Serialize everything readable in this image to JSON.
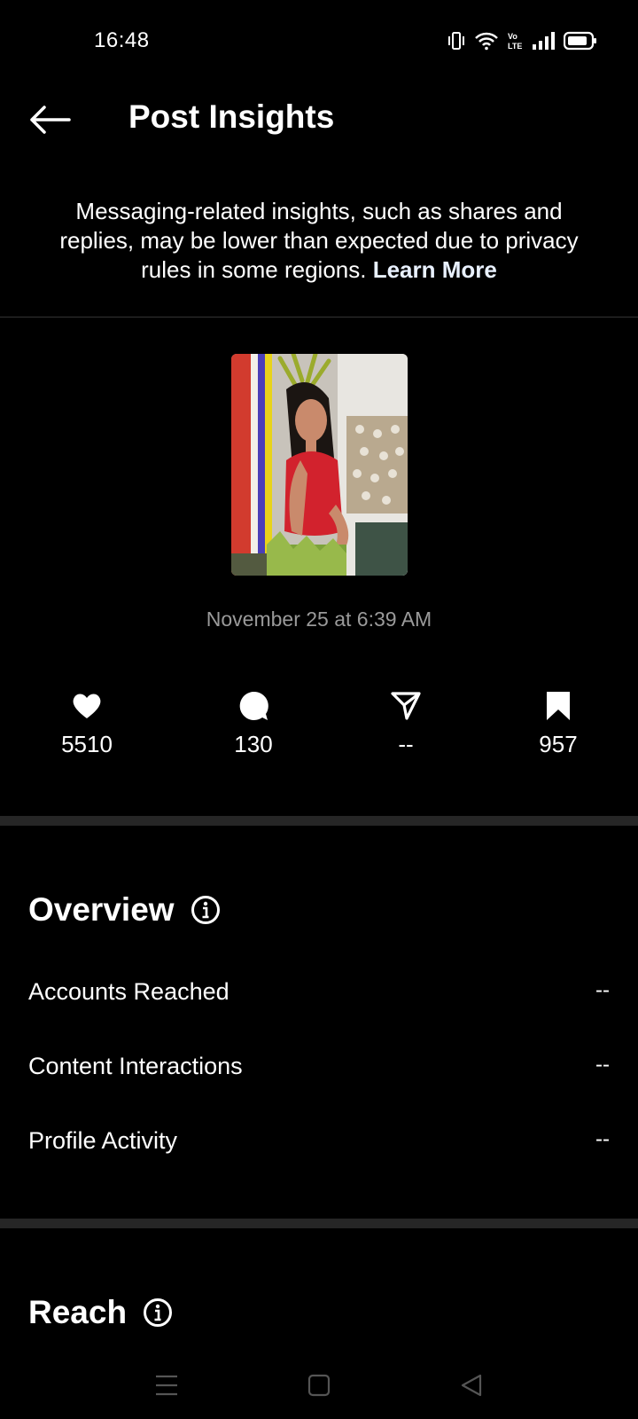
{
  "status": {
    "time": "16:48",
    "icons": [
      "vibrate-icon",
      "wifi-icon",
      "volte-icon",
      "signal-icon",
      "battery-icon"
    ],
    "volte_label": "Vo\nLTE"
  },
  "header": {
    "title": "Post Insights",
    "back_icon": "back-arrow-icon"
  },
  "notice": {
    "text": "Messaging-related insights, such as shares and replies, may be lower than expected due to privacy rules in some regions.",
    "link": "Learn More"
  },
  "post": {
    "date": "November 25 at 6:39 AM"
  },
  "metrics": [
    {
      "icon": "heart-icon",
      "value": "5510"
    },
    {
      "icon": "comment-icon",
      "value": "130"
    },
    {
      "icon": "share-icon",
      "value": "--"
    },
    {
      "icon": "bookmark-icon",
      "value": "957"
    }
  ],
  "overview": {
    "title": "Overview",
    "rows": [
      {
        "label": "Accounts Reached",
        "value": "--"
      },
      {
        "label": "Content Interactions",
        "value": "--"
      },
      {
        "label": "Profile Activity",
        "value": "--"
      }
    ]
  },
  "reach": {
    "title": "Reach"
  },
  "colors": {
    "background": "#000000",
    "text": "#ffffff",
    "muted": "#9a9a9a",
    "divider": "#262626"
  }
}
